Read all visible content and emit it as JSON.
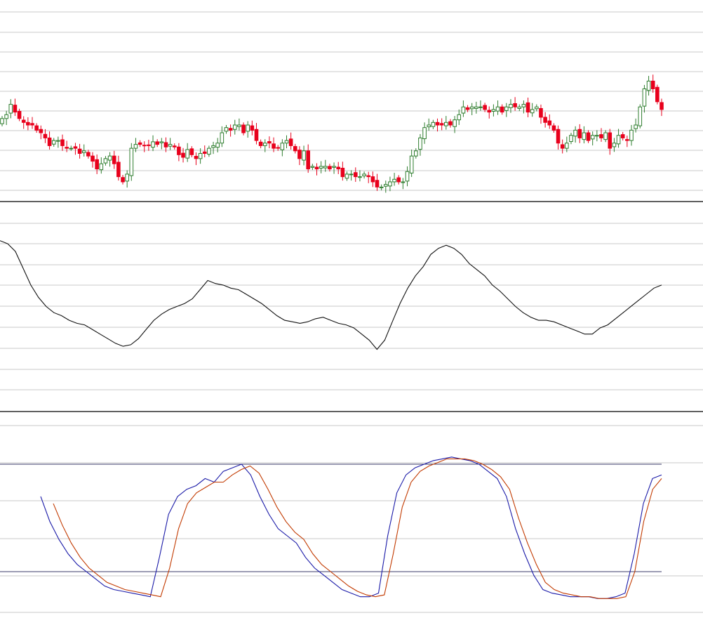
{
  "chart_data": [
    {
      "type": "candlestick",
      "title": "",
      "xlabel": "",
      "ylabel": "",
      "ylim": [
        0,
        100
      ],
      "grid": true,
      "colors": {
        "up": "#2e7d2e",
        "down": "#e8001c",
        "wick": "#2e7d2e"
      },
      "series": [
        {
          "close": [
            55,
            58,
            66,
            60,
            55,
            52,
            50,
            50,
            46,
            44,
            40,
            34,
            38,
            38,
            34,
            32,
            32,
            32,
            28,
            30,
            26,
            22,
            16,
            20,
            24,
            26,
            20,
            10,
            6,
            12,
            32,
            35,
            35,
            34,
            34,
            37,
            35,
            37,
            33,
            35,
            33,
            27,
            25,
            31,
            27,
            24,
            28,
            28,
            32,
            34,
            36,
            44,
            48,
            46,
            50,
            50,
            44,
            50,
            46,
            38,
            34,
            36,
            36,
            32,
            32,
            36,
            38,
            34,
            30,
            24,
            30,
            16,
            18,
            16,
            18,
            18,
            16,
            18,
            16,
            10,
            12,
            12,
            10,
            10,
            12,
            10,
            6,
            2,
            2,
            4,
            6,
            8,
            6,
            6,
            14,
            26,
            30,
            40,
            48,
            50,
            52,
            50,
            50,
            52,
            50,
            54,
            58,
            64,
            62,
            64,
            64,
            64,
            62,
            60,
            62,
            64,
            60,
            64,
            66,
            64,
            64,
            66,
            60,
            62,
            64,
            56,
            52,
            50,
            46,
            36,
            32,
            36,
            42,
            46,
            40,
            44,
            38,
            42,
            42,
            40,
            44,
            32,
            36,
            42,
            40,
            38,
            46,
            50,
            64,
            78,
            84,
            78,
            68,
            62
          ]
        }
      ]
    },
    {
      "type": "line",
      "title": "",
      "xlabel": "",
      "ylabel": "",
      "ylim": [
        0,
        100
      ],
      "grid": true,
      "series": [
        {
          "color": "#111111",
          "values": [
            85,
            83,
            78,
            67,
            56,
            48,
            42,
            38,
            36,
            33,
            31,
            30,
            27,
            24,
            21,
            18,
            16,
            17,
            21,
            27,
            33,
            37,
            40,
            42,
            44,
            47,
            53,
            59,
            57,
            56,
            54,
            53,
            50,
            47,
            44,
            40,
            36,
            33,
            32,
            31,
            32,
            34,
            35,
            33,
            31,
            30,
            28,
            24,
            20,
            14,
            20,
            32,
            44,
            54,
            62,
            68,
            76,
            80,
            82,
            80,
            76,
            70,
            66,
            62,
            56,
            52,
            47,
            42,
            38,
            35,
            33,
            33,
            32,
            30,
            28,
            26,
            24,
            24,
            28,
            30,
            34,
            38,
            42,
            46,
            50,
            54,
            56
          ]
        }
      ]
    },
    {
      "type": "line",
      "title": "",
      "xlabel": "",
      "ylabel": "",
      "ylim": [
        0,
        100
      ],
      "grid": true,
      "reference_lines": [
        20,
        80
      ],
      "series": [
        {
          "color": "#1a1aa8",
          "values": [
            62,
            48,
            38,
            30,
            24,
            20,
            16,
            12,
            10,
            9,
            8,
            7,
            6,
            28,
            52,
            62,
            66,
            68,
            72,
            70,
            76,
            78,
            80,
            74,
            62,
            52,
            44,
            40,
            36,
            28,
            22,
            18,
            14,
            10,
            8,
            6,
            6,
            8,
            40,
            64,
            74,
            78,
            80,
            82,
            83,
            84,
            83,
            82,
            80,
            76,
            72,
            62,
            44,
            30,
            18,
            10,
            8,
            7,
            6,
            6,
            6,
            5,
            5,
            6,
            8,
            30,
            58,
            72,
            74
          ]
        },
        {
          "color": "#c23a00",
          "values": [
            58,
            46,
            36,
            28,
            22,
            18,
            14,
            12,
            10,
            9,
            8,
            7,
            6,
            22,
            44,
            58,
            64,
            67,
            70,
            70,
            74,
            77,
            79,
            75,
            66,
            56,
            48,
            42,
            38,
            30,
            24,
            20,
            16,
            12,
            9,
            7,
            6,
            7,
            30,
            56,
            70,
            76,
            79,
            81,
            83,
            83,
            83,
            82,
            80,
            77,
            73,
            66,
            50,
            36,
            24,
            14,
            10,
            8,
            7,
            6,
            6,
            5,
            5,
            5,
            6,
            20,
            48,
            66,
            72
          ]
        }
      ]
    }
  ]
}
